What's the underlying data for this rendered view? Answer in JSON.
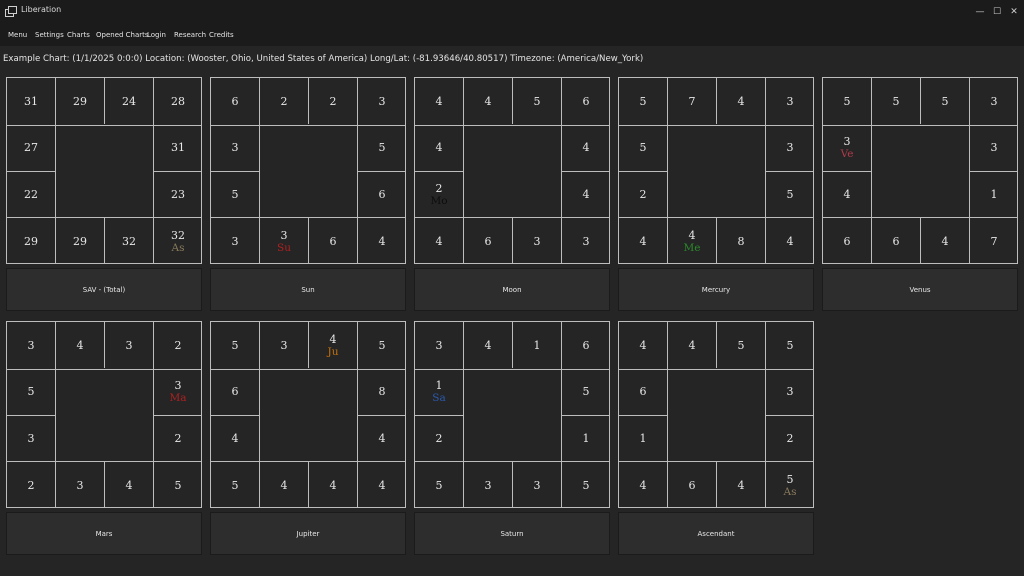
{
  "window": {
    "title": "Liberation",
    "minimize_glyph": "—",
    "maximize_glyph": "☐",
    "close_glyph": "✕"
  },
  "menu": [
    "Menu",
    "Settings",
    "Charts",
    "Opened Charts",
    "Login",
    "Research",
    "Credits"
  ],
  "chart_info": "Example Chart: (1/1/2025 0:0:0) Location: (Wooster, Ohio, United States of America) Long/Lat: (-81.93646/40.80517) Timezone: (America/New_York)",
  "charts": [
    {
      "label": "SAV - (Total)",
      "cells": [
        "31",
        "29",
        "24",
        "28",
        "31",
        "23",
        "32",
        "32",
        "29",
        "29",
        "22",
        "27"
      ],
      "planets": {
        "6": {
          "abbr": "As",
          "color": "#8a7b5c"
        }
      }
    },
    {
      "label": "Sun",
      "cells": [
        "6",
        "2",
        "2",
        "3",
        "5",
        "6",
        "4",
        "6",
        "3",
        "3",
        "5",
        "3"
      ],
      "planets": {
        "8": {
          "abbr": "Su",
          "color": "#b02020"
        }
      }
    },
    {
      "label": "Moon",
      "cells": [
        "4",
        "4",
        "5",
        "6",
        "4",
        "4",
        "3",
        "3",
        "6",
        "4",
        "2",
        "4"
      ],
      "planets": {
        "10": {
          "abbr": "Mo",
          "color": "#0d0d0d"
        }
      }
    },
    {
      "label": "Mercury",
      "cells": [
        "5",
        "7",
        "4",
        "3",
        "3",
        "5",
        "4",
        "8",
        "4",
        "4",
        "2",
        "5"
      ],
      "planets": {
        "8": {
          "abbr": "Me",
          "color": "#2a8a2a"
        }
      }
    },
    {
      "label": "Venus",
      "cells": [
        "5",
        "5",
        "5",
        "3",
        "3",
        "1",
        "7",
        "4",
        "6",
        "6",
        "4",
        "3"
      ],
      "planets": {
        "11": {
          "abbr": "Ve",
          "color": "#b03a4a"
        }
      }
    },
    {
      "label": "Mars",
      "cells": [
        "3",
        "4",
        "3",
        "2",
        "3",
        "2",
        "5",
        "4",
        "3",
        "2",
        "3",
        "5"
      ],
      "planets": {
        "4": {
          "abbr": "Ma",
          "color": "#b02020"
        }
      }
    },
    {
      "label": "Jupiter",
      "cells": [
        "5",
        "3",
        "4",
        "5",
        "8",
        "4",
        "4",
        "4",
        "4",
        "5",
        "4",
        "6"
      ],
      "planets": {
        "2": {
          "abbr": "Ju",
          "color": "#c8720a"
        }
      }
    },
    {
      "label": "Saturn",
      "cells": [
        "3",
        "4",
        "1",
        "6",
        "5",
        "1",
        "5",
        "3",
        "3",
        "5",
        "2",
        "1"
      ],
      "planets": {
        "11": {
          "abbr": "Sa",
          "color": "#2a5ab0"
        }
      }
    },
    {
      "label": "Ascendant",
      "cells": [
        "4",
        "4",
        "5",
        "5",
        "3",
        "2",
        "5",
        "4",
        "6",
        "4",
        "1",
        "6"
      ],
      "planets": {
        "6": {
          "abbr": "As",
          "color": "#8a7b5c"
        }
      }
    }
  ]
}
